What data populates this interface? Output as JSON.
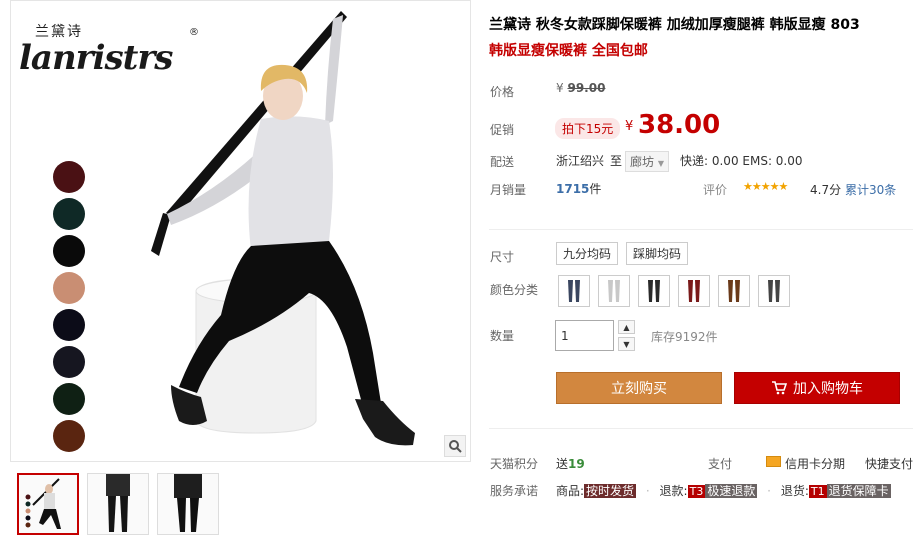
{
  "brand": {
    "cn": "兰黛诗",
    "en": "lanristrs",
    "reg": "®"
  },
  "gallery": {
    "swatches": [
      {
        "color": "#4a1114"
      },
      {
        "color": "#0f2926"
      },
      {
        "color": "#0a0a0a"
      },
      {
        "color": "#c98e73"
      },
      {
        "color": "#0c0c18"
      },
      {
        "color": "#161620"
      },
      {
        "color": "#0f2014"
      },
      {
        "color": "#5a2510"
      }
    ],
    "zoom_icon": "magnifier-icon",
    "thumbnails": [
      {
        "active": true
      },
      {
        "active": false
      },
      {
        "active": false
      }
    ]
  },
  "product": {
    "title": "兰黛诗 秋冬女款踩脚保暖裤 加绒加厚瘦腿裤 韩版显瘦 803",
    "subtitle": "韩版显瘦保暖裤 全国包邮",
    "labels": {
      "price": "价格",
      "promo": "促销",
      "shipping": "配送",
      "monthly_sales": "月销量",
      "size": "尺寸",
      "color": "颜色分类",
      "quantity": "数量",
      "points": "天猫积分",
      "service": "服务承诺"
    },
    "original_price": {
      "symbol": "¥",
      "value": "99.00"
    },
    "promo_tag": "拍下15元",
    "current_price": {
      "symbol": "¥",
      "value": "38.00"
    },
    "shipping": {
      "from": "浙江绍兴",
      "to_word": "至",
      "dest": "廊坊",
      "fees": "快递: 0.00 EMS: 0.00"
    },
    "sales": {
      "count": "1715",
      "unit": "件"
    },
    "reviews": {
      "label": "评价",
      "stars": "★★★★★",
      "score": "4.7分",
      "count_text": "累计30条"
    },
    "sizes": [
      "九分均码",
      "踩脚均码"
    ],
    "color_options": [
      {
        "leg": "#3a4660"
      },
      {
        "leg": "#c8c8c8"
      },
      {
        "leg": "#2a2a2a"
      },
      {
        "leg": "#7a1a1a"
      },
      {
        "leg": "#6a3a1a"
      },
      {
        "leg": "#444444"
      }
    ],
    "quantity_value": "1",
    "stock": "库存9192件",
    "buy_now": "立刻购买",
    "add_to_cart": "加入购物车",
    "points": {
      "prefix": "送",
      "value": "19"
    },
    "pay": {
      "label": "支付",
      "card": "信用卡分期",
      "quick": "快捷支付"
    },
    "service": {
      "goods_label": "商品:",
      "goods_tag": "按时发货",
      "refund_label": "退款:",
      "refund_badge": "T3",
      "refund_tag": "极速退款",
      "return_label": "退货:",
      "return_badge": "T1",
      "return_tag": "退货保障卡"
    }
  },
  "colors": {
    "accent_red": "#c40000",
    "buy_orange": "#d2873f",
    "link_blue": "#3c6ea8"
  }
}
